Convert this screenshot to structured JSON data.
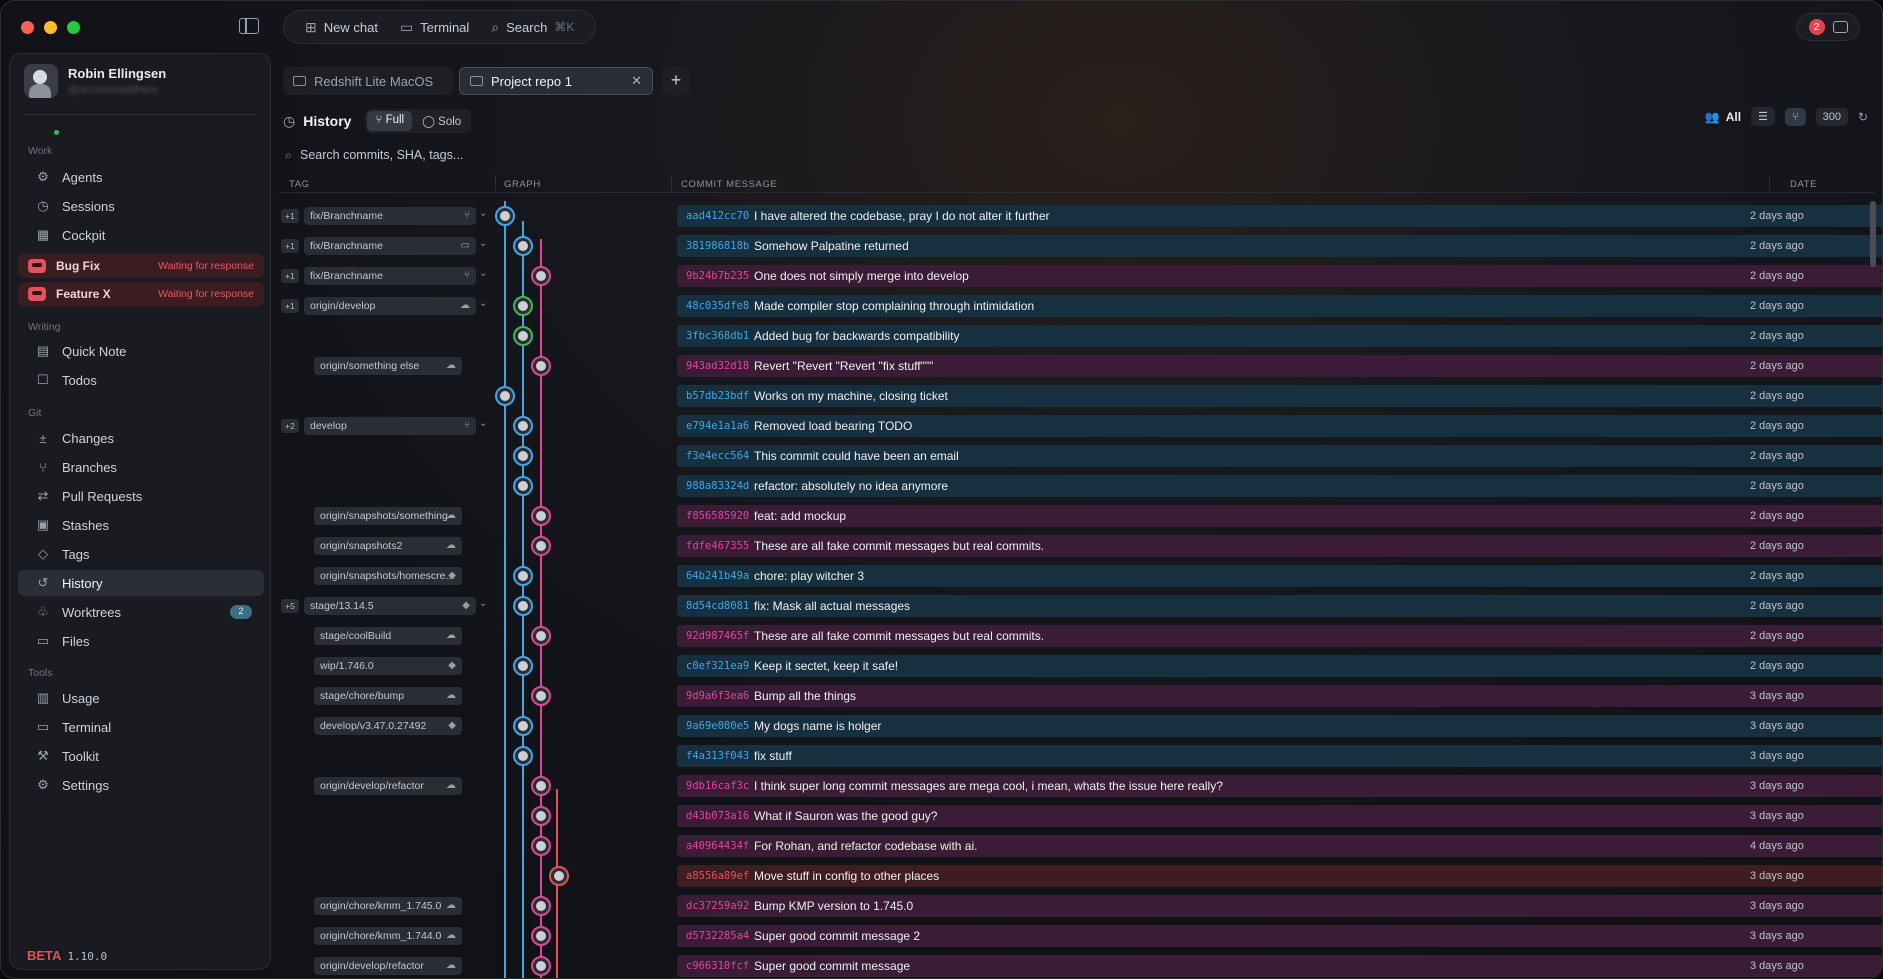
{
  "colors": {
    "blue": "#3fa6e8",
    "pink": "#e0459a",
    "red": "#e4515b",
    "green": "#3fb950",
    "purple": "#b06adb",
    "white": "#e9ebee"
  },
  "topbar": {
    "new_chat": "New chat",
    "terminal": "Terminal",
    "search": "Search",
    "search_kbd": "⌘K",
    "notif_count": "2"
  },
  "user": {
    "name": "Robin Ellingsen",
    "handle": "@accountaddhere"
  },
  "sidebar": {
    "work_label": "Work",
    "work": [
      "Agents",
      "Sessions",
      "Cockpit"
    ],
    "agents": [
      {
        "name": "Bug Fix",
        "status": "Waiting for response"
      },
      {
        "name": "Feature X",
        "status": "Waiting for response"
      }
    ],
    "writing_label": "Writing",
    "writing": [
      "Quick Note",
      "Todos"
    ],
    "git_label": "Git",
    "git": [
      "Changes",
      "Branches",
      "Pull Requests",
      "Stashes",
      "Tags",
      "History",
      "Worktrees",
      "Files"
    ],
    "worktrees_count": "2",
    "tools_label": "Tools",
    "tools": [
      "Usage",
      "Terminal",
      "Toolkit",
      "Settings"
    ],
    "beta": "BETA",
    "version": "1.10.0"
  },
  "tabs": [
    {
      "label": "Redshift Lite MacOS"
    },
    {
      "label": "Project repo 1"
    }
  ],
  "history": {
    "title": "History",
    "mode_full": "Full",
    "mode_solo": "Solo",
    "filter_all": "All",
    "limit": "300",
    "search_placeholder": "Search commits, SHA, tags..."
  },
  "columns": {
    "tag": "TAG",
    "graph": "GRAPH",
    "message": "COMMIT MESSAGE",
    "date": "DATE"
  },
  "commits": [
    {
      "plus": "+1",
      "tag": "fix/Branchname",
      "tagicon": "⑂",
      "sha": "aad412cc70",
      "msg": "I have altered the codebase, pray I do not alter it further",
      "date": "2 days ago",
      "lane": 0,
      "color": "blue"
    },
    {
      "plus": "+1",
      "tag": "fix/Branchname",
      "tagicon": "▭",
      "sha": "381986818b",
      "msg": "Somehow Palpatine returned",
      "date": "2 days ago",
      "lane": 1,
      "color": "blue"
    },
    {
      "plus": "+1",
      "tag": "fix/Branchname",
      "tagicon": "⑂",
      "sha": "9b24b7b235",
      "msg": "One does not simply merge into develop",
      "date": "2 days ago",
      "lane": 2,
      "color": "pink"
    },
    {
      "plus": "+1",
      "tag": "origin/develop",
      "tagicon": "☁",
      "sha": "48c035dfe8",
      "msg": "Made compiler stop complaining through intimidation",
      "date": "2 days ago",
      "lane": 1,
      "color": "green"
    },
    {
      "plus": "",
      "tag": "",
      "tagicon": "",
      "sha": "3fbc368db1",
      "msg": "Added bug for backwards compatibility",
      "date": "2 days ago",
      "lane": 1,
      "color": "green"
    },
    {
      "plus": "",
      "tag": "origin/something else",
      "tagicon": "☁",
      "sha": "943ad32d18",
      "msg": "Revert \"Revert \"Revert \"fix stuff\"\"\"",
      "date": "2 days ago",
      "lane": 2,
      "color": "pink"
    },
    {
      "plus": "",
      "tag": "",
      "tagicon": "",
      "sha": "b57db23bdf",
      "msg": "Works on my machine, closing ticket",
      "date": "2 days ago",
      "lane": 0,
      "color": "blue"
    },
    {
      "plus": "+2",
      "tag": "develop",
      "tagicon": "⑂",
      "sha": "e794e1a1a6",
      "msg": "Removed load bearing TODO",
      "date": "2 days ago",
      "lane": 1,
      "color": "blue"
    },
    {
      "plus": "",
      "tag": "",
      "tagicon": "",
      "sha": "f3e4ecc564",
      "msg": "This commit could have been an email",
      "date": "2 days ago",
      "lane": 1,
      "color": "blue"
    },
    {
      "plus": "",
      "tag": "",
      "tagicon": "",
      "sha": "988a83324d",
      "msg": "refactor: absolutely no idea anymore",
      "date": "2 days ago",
      "lane": 1,
      "color": "blue"
    },
    {
      "plus": "",
      "tag": "origin/snapshots/something",
      "tagicon": "☁",
      "sha": "f856585920",
      "msg": "feat: add mockup",
      "date": "2 days ago",
      "lane": 2,
      "color": "pink"
    },
    {
      "plus": "",
      "tag": "origin/snapshots2",
      "tagicon": "☁",
      "sha": "fdfe467355",
      "msg": "These are all fake commit messages but real commits.",
      "date": "2 days ago",
      "lane": 2,
      "color": "pink"
    },
    {
      "plus": "",
      "tag": "origin/snapshots/homescre...",
      "tagicon": "◆",
      "sha": "64b241b49a",
      "msg": "chore: play witcher 3",
      "date": "2 days ago",
      "lane": 1,
      "color": "blue"
    },
    {
      "plus": "+5",
      "tag": "stage/13.14.5",
      "tagicon": "◆",
      "sha": "8d54cd8081",
      "msg": "fix: Mask all actual messages",
      "date": "2 days ago",
      "lane": 1,
      "color": "blue"
    },
    {
      "plus": "",
      "tag": "stage/coolBuild",
      "tagicon": "☁",
      "sha": "92d987465f",
      "msg": "These are all fake commit messages but real commits.",
      "date": "2 days ago",
      "lane": 2,
      "color": "pink"
    },
    {
      "plus": "",
      "tag": "wip/1.746.0",
      "tagicon": "◆",
      "sha": "c0ef321ea9",
      "msg": "Keep it sectet, keep it safe!",
      "date": "2 days ago",
      "lane": 1,
      "color": "blue"
    },
    {
      "plus": "",
      "tag": "stage/chore/bump",
      "tagicon": "☁",
      "sha": "9d9a6f3ea6",
      "msg": "Bump all the things",
      "date": "3 days ago",
      "lane": 2,
      "color": "pink"
    },
    {
      "plus": "",
      "tag": "develop/v3.47.0.27492",
      "tagicon": "◆",
      "sha": "9a69e080e5",
      "msg": "My dogs name is holger",
      "date": "3 days ago",
      "lane": 1,
      "color": "blue"
    },
    {
      "plus": "",
      "tag": "",
      "tagicon": "",
      "sha": "f4a313f043",
      "msg": "fix stuff",
      "date": "3 days ago",
      "lane": 1,
      "color": "blue"
    },
    {
      "plus": "",
      "tag": "origin/develop/refactor",
      "tagicon": "☁",
      "sha": "9db16caf3c",
      "msg": "I think super long commit messages are mega cool, i mean, whats the issue here really?",
      "date": "3 days ago",
      "lane": 2,
      "color": "pink"
    },
    {
      "plus": "",
      "tag": "",
      "tagicon": "",
      "sha": "d43b073a16",
      "msg": "What if Sauron was the good guy?",
      "date": "3 days ago",
      "lane": 2,
      "color": "pink"
    },
    {
      "plus": "",
      "tag": "",
      "tagicon": "",
      "sha": "a40964434f",
      "msg": "For Rohan, and refactor codebase with ai.",
      "date": "4 days ago",
      "lane": 2,
      "color": "pink"
    },
    {
      "plus": "",
      "tag": "",
      "tagicon": "",
      "sha": "a8556a89ef",
      "msg": "Move stuff in config to other places",
      "date": "3 days ago",
      "lane": 3,
      "color": "red"
    },
    {
      "plus": "",
      "tag": "origin/chore/kmm_1.745.0",
      "tagicon": "☁",
      "sha": "dc37259a92",
      "msg": "Bump KMP version to 1.745.0",
      "date": "3 days ago",
      "lane": 2,
      "color": "pink"
    },
    {
      "plus": "",
      "tag": "origin/chore/kmm_1.744.0",
      "tagicon": "☁",
      "sha": "d5732285a4",
      "msg": "Super good commit message 2",
      "date": "3 days ago",
      "lane": 2,
      "color": "pink"
    },
    {
      "plus": "",
      "tag": "origin/develop/refactor",
      "tagicon": "☁",
      "sha": "c966310fcf",
      "msg": "Super good commit message",
      "date": "3 days ago",
      "lane": 2,
      "color": "pink"
    }
  ]
}
